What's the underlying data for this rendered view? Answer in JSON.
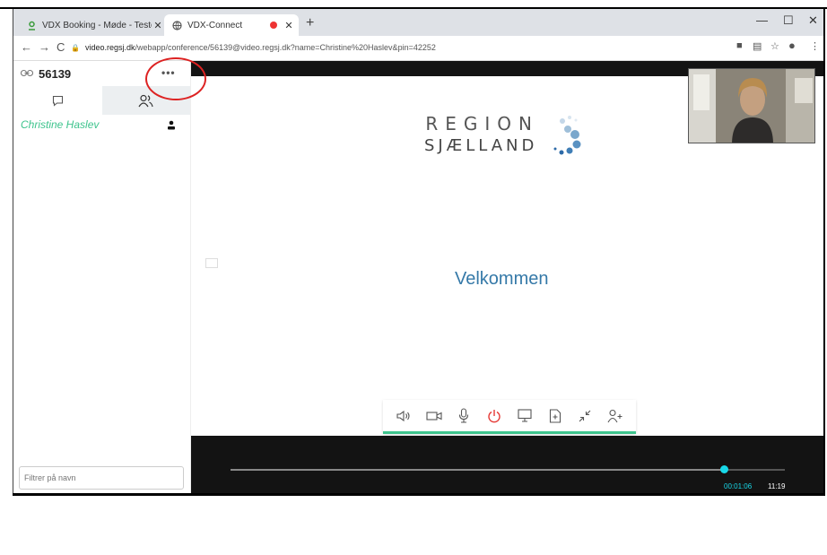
{
  "browser": {
    "tabs": [
      {
        "title": "VDX Booking - Møde - Testopkal"
      },
      {
        "title": "VDX-Connect"
      }
    ],
    "url_host": "video.regsj.dk",
    "url_path": "/webapp/conference/56139@video.regsj.dk?name=Christine%20Haslev&pin=42252"
  },
  "sidebar": {
    "conference_id": "56139",
    "participants": [
      {
        "name": "Christine Haslev"
      }
    ],
    "filter_placeholder": "Filtrer på navn"
  },
  "stage": {
    "logo_line1": "REGION",
    "logo_line2": "SJÆLLAND",
    "welcome": "Velkommen",
    "time_current": "00:01:06",
    "time_total": "11:19",
    "progress_fraction": 0.89
  },
  "colors": {
    "accent": "#3ec48d",
    "welcome": "#3579a8",
    "timeline": "#18d8e8",
    "hangup": "#e53935"
  },
  "controls": [
    "speaker-icon",
    "camera-icon",
    "microphone-icon",
    "power-icon",
    "screen-share-icon",
    "add-file-icon",
    "minimize-icon",
    "add-person-icon"
  ]
}
